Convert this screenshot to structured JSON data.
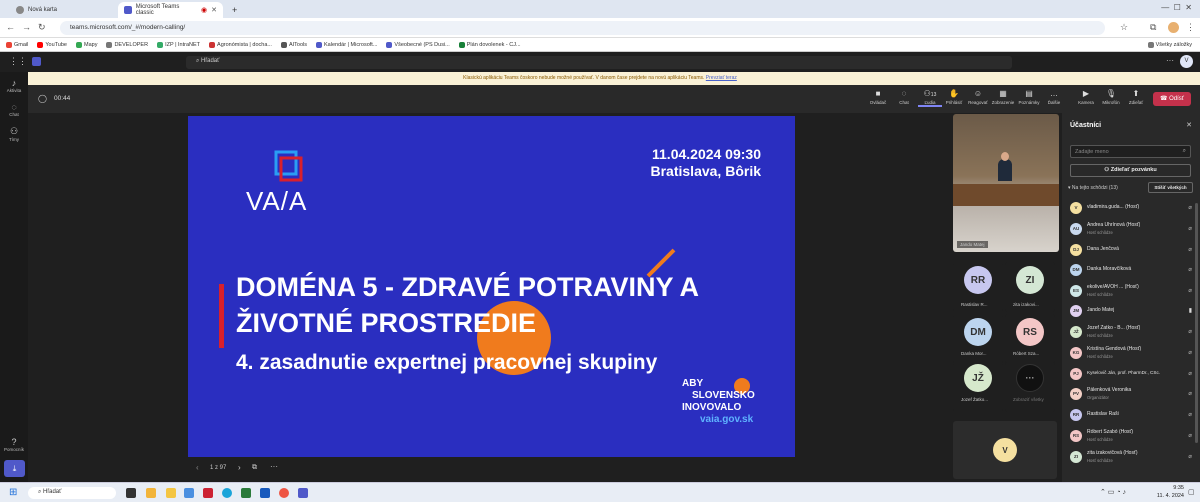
{
  "browser": {
    "tabs": [
      {
        "label": "Nová karta",
        "active": false
      },
      {
        "label": "Microsoft Teams classic",
        "active": true
      }
    ],
    "new_tab": "+",
    "url": "teams.microsoft.com/_#/modern-calling/",
    "bookmarks": [
      "Gmail",
      "YouTube",
      "Mapy",
      "DEVELOPER",
      "IZP | IntraNET",
      "Agronómista | docha...",
      "AITools",
      "Kalendár | Microsoft...",
      "Všeobecné (PS Dusi...",
      "Plán dovolenek - CJ..."
    ],
    "all_bookmarks": "Všetky záložky"
  },
  "teams": {
    "search_placeholder": "Hľadať",
    "avatar": "V",
    "banner_text": "Klasickú aplikáciu Teams čoskoro nebude možné používať. V danom čase prejdete na novú aplikáciu Teams.",
    "banner_link": "Prevziať teraz",
    "rail": [
      {
        "label": "Aktivita",
        "icon": "bell-icon"
      },
      {
        "label": "Chat",
        "icon": "chat-icon"
      },
      {
        "label": "Tímy",
        "icon": "teams-icon"
      },
      {
        "label": "Pomocník",
        "icon": "help-icon"
      }
    ]
  },
  "meeting": {
    "timer": "00:44",
    "toolbar": [
      {
        "label": "Ovládač",
        "icon": "■"
      },
      {
        "label": "Chat",
        "icon": "◌"
      },
      {
        "label": "Ľudia",
        "icon": "⚇",
        "badge": "13"
      },
      {
        "label": "Prihlásiť",
        "icon": "✋"
      },
      {
        "label": "Reagovať",
        "icon": "☺"
      },
      {
        "label": "Zobrazenie",
        "icon": "▦"
      },
      {
        "label": "Poznámky",
        "icon": "▤"
      },
      {
        "label": "Ďalšie",
        "icon": "…"
      },
      {
        "label": "Kamera",
        "icon": "▶"
      },
      {
        "label": "Mikrofón",
        "icon": "🎙"
      },
      {
        "label": "Zdieľať",
        "icon": "⬆"
      }
    ],
    "leave_label": "Odísť",
    "slide_nav": {
      "page": "1 z 97"
    }
  },
  "slide": {
    "logo_text": "VA/A",
    "date": "11.04.2024 09:30",
    "place": "Bratislava, Bôrik",
    "title_line1": "DOMÉNA 5 - ZDRAVÉ POTRAVINY A",
    "title_line2": "ŽIVOTNÉ PROSTREDIE",
    "subtitle": "4. zasadnutie expertnej pracovnej skupiny",
    "tag_line1": "ABY",
    "tag_line2": "SLOVENSKO",
    "tag_line3": "INOVOVALO",
    "tag_url": "vaia.gov.sk",
    "colors": {
      "bg": "#2a2ec0",
      "accent_orange": "#f07b1d",
      "accent_red": "#d9202c"
    }
  },
  "videos": {
    "main_label": "Jando Matej",
    "tiles": [
      {
        "initials": "RR",
        "label": "Rastislav R...",
        "color": "#c7c7ef"
      },
      {
        "initials": "ZI",
        "label": "zita izakovi...",
        "color": "#d4e7d4"
      },
      {
        "initials": "DM",
        "label": "Danka Mor...",
        "color": "#bcd4ee"
      },
      {
        "initials": "RS",
        "label": "Róbert Sza...",
        "color": "#f3c6c6"
      },
      {
        "initials": "JŽ",
        "label": "Jozef Žatko...",
        "color": "#d6e8cc"
      },
      {
        "initials": "···",
        "label": "Zobraziť všetky",
        "color": "#1f1f1f"
      }
    ],
    "self_avatar": "V"
  },
  "participants": {
    "title": "Účastníci",
    "search_placeholder": "Zadajte meno",
    "share_invite": "Zdieľať pozvánku",
    "section_label": "Na tejto schôdzi (13)",
    "mute_all": "Stíšiť všetkých",
    "list": [
      {
        "initials": "V",
        "name": "vladimira.guda... (Hosť)",
        "sub": "",
        "color": "#f5e0a0"
      },
      {
        "initials": "AU",
        "name": "Andrea Uhrínová (Hosť)",
        "sub": "Hosť schôdze",
        "color": "#c9d9ee"
      },
      {
        "initials": "DJ",
        "name": "Dana Jenčová",
        "sub": "",
        "color": "#f5e0a0"
      },
      {
        "initials": "DM",
        "name": "Danka Moravčíková",
        "sub": "",
        "color": "#bcd4ee"
      },
      {
        "initials": "ES",
        "name": "ekolive/AVOH ... (Hosť)",
        "sub": "Hosť schôdze",
        "color": "#cfe8e8"
      },
      {
        "initials": "JM",
        "name": "Jando Matej",
        "sub": "",
        "color": "#e0d0f0"
      },
      {
        "initials": "JŽ",
        "name": "Jozef Žatko - B... (Hosť)",
        "sub": "Hosť schôdze",
        "color": "#d6e8cc"
      },
      {
        "initials": "KG",
        "name": "Kristína Gendová (Hosť)",
        "sub": "Hosť schôdze",
        "color": "#f3c6c6"
      },
      {
        "initials": "PJ",
        "name": "Kyselovič Ján, prof. PharmDr., CSc.",
        "sub": "",
        "color": "#f3c6c6"
      },
      {
        "initials": "PV",
        "name": "Pálenková Veronika",
        "sub": "Organizátor",
        "color": "#f3d0c6"
      },
      {
        "initials": "RR",
        "name": "Rastislav Raši",
        "sub": "",
        "color": "#c7c7ef"
      },
      {
        "initials": "RS",
        "name": "Róbert Szabó (Hosť)",
        "sub": "Hosť schôdze",
        "color": "#f3c6c6"
      },
      {
        "initials": "ZI",
        "name": "zita izakovičová (Hosť)",
        "sub": "Hosť schôdze",
        "color": "#d4e7d4"
      }
    ]
  },
  "taskbar": {
    "search_placeholder": "Hľadať",
    "time": "9:35",
    "date": "11. 4. 2024"
  }
}
